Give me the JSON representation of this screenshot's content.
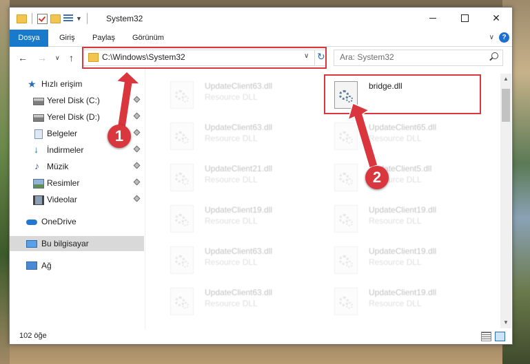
{
  "window": {
    "title": "System32",
    "ribbon_tabs": [
      "Dosya",
      "Giriş",
      "Paylaş",
      "Görünüm"
    ],
    "help_label": "?"
  },
  "nav": {
    "address": "C:\\Windows\\System32",
    "search_placeholder": "Ara: System32"
  },
  "sidebar": {
    "items": [
      {
        "label": "Hızlı erişim",
        "icon": "quick-access-star-icon",
        "pinned": false
      },
      {
        "label": "Yerel Disk (C:)",
        "icon": "local-disk-icon",
        "pinned": true
      },
      {
        "label": "Yerel Disk (D:)",
        "icon": "local-disk-icon",
        "pinned": true
      },
      {
        "label": "Belgeler",
        "icon": "documents-icon",
        "pinned": true
      },
      {
        "label": "İndirmeler",
        "icon": "downloads-icon",
        "pinned": true
      },
      {
        "label": "Müzik",
        "icon": "music-icon",
        "pinned": true
      },
      {
        "label": "Resimler",
        "icon": "pictures-icon",
        "pinned": true
      },
      {
        "label": "Videolar",
        "icon": "videos-icon",
        "pinned": true
      },
      {
        "label": "OneDrive",
        "icon": "onedrive-icon",
        "pinned": false
      },
      {
        "label": "Bu bilgisayar",
        "icon": "this-pc-icon",
        "pinned": false,
        "selected": true
      },
      {
        "label": "Ağ",
        "icon": "network-icon",
        "pinned": false
      }
    ]
  },
  "files": [
    {
      "name": "UpdateClient63.dll",
      "type": "Resource DLL"
    },
    {
      "name": "bridge.dll",
      "type": ""
    },
    {
      "name": "UpdateClient63.dll",
      "type": "Resource DLL"
    },
    {
      "name": "UpdateClient65.dll",
      "type": "Resource DLL"
    },
    {
      "name": "UpdateClient21.dll",
      "type": "Resource DLL"
    },
    {
      "name": "UpdateClient5.dll",
      "type": "Resource DLL"
    },
    {
      "name": "UpdateClient19.dll",
      "type": "Resource DLL"
    },
    {
      "name": "UpdateClient19.dll",
      "type": "Resource DLL"
    },
    {
      "name": "UpdateClient63.dll",
      "type": "Resource DLL"
    },
    {
      "name": "UpdateClient19.dll",
      "type": "Resource DLL"
    },
    {
      "name": "UpdateClient63.dll",
      "type": "Resource DLL"
    },
    {
      "name": "UpdateClient19.dll",
      "type": "Resource DLL"
    }
  ],
  "status": {
    "item_count": "102 öğe"
  },
  "annotations": {
    "step1": "1",
    "step2": "2",
    "color": "#d9363e"
  },
  "colors": {
    "file_tab": "#1979ca",
    "selected_nav": "#d9d9d9"
  }
}
